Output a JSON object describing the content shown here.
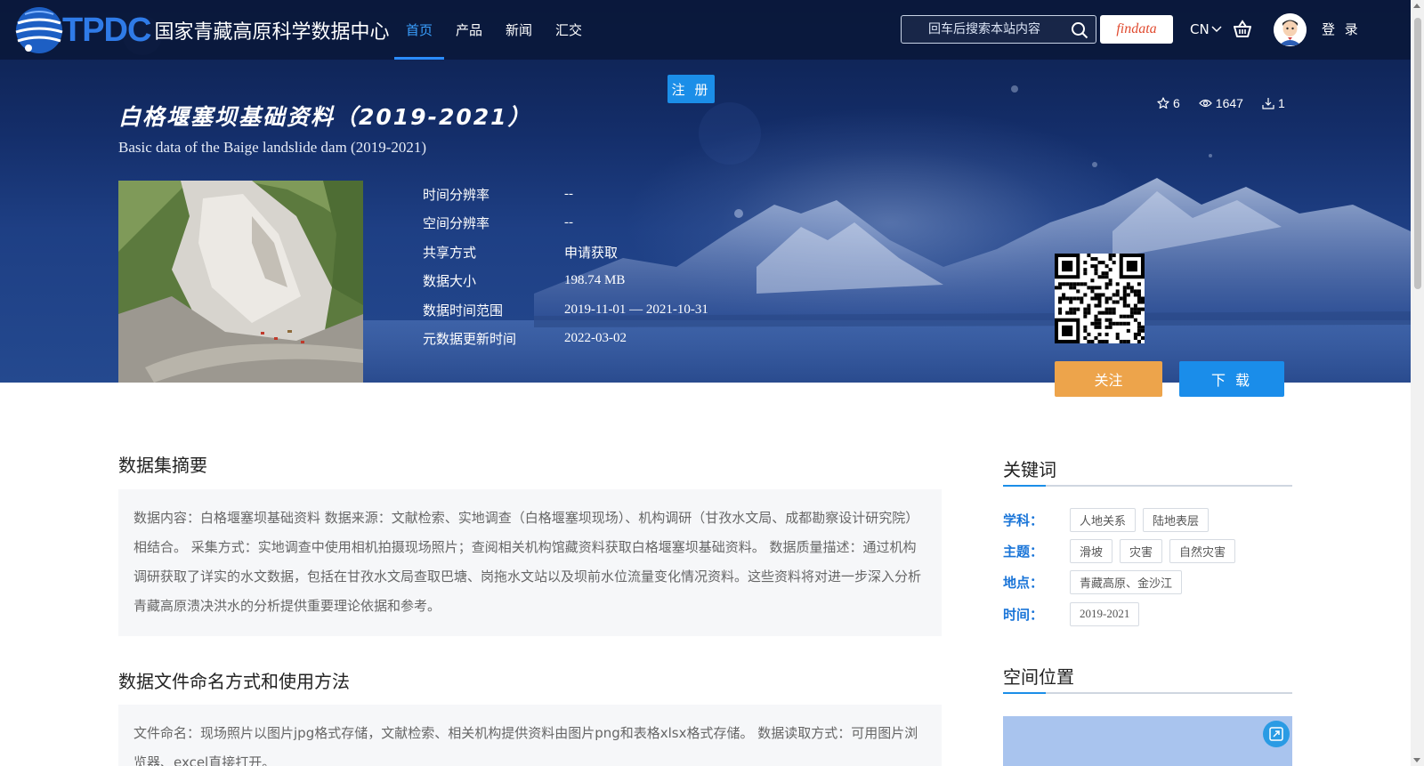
{
  "nav": {
    "logo_en": "TPDC",
    "logo_cn": "国家青藏高原科学数据中心",
    "menu": [
      {
        "label": "首页",
        "active": true
      },
      {
        "label": "产品",
        "active": false
      },
      {
        "label": "新闻",
        "active": false
      },
      {
        "label": "汇交",
        "active": false
      }
    ],
    "search_placeholder": "回车后搜索本站内容",
    "findata_label": "findata",
    "lang": "CN",
    "login": "登 录",
    "register": "注 册"
  },
  "dataset": {
    "title_cn": "白格堰塞坝基础资料（2019-2021）",
    "title_en": "Basic data of the Baige landslide dam (2019-2021)",
    "stats": {
      "stars": "6",
      "views": "1647",
      "downloads": "1"
    },
    "meta": [
      {
        "label": "时间分辨率",
        "value": "--"
      },
      {
        "label": "空间分辨率",
        "value": "--"
      },
      {
        "label": "共享方式",
        "value": "申请获取"
      },
      {
        "label": "数据大小",
        "value": "198.74 MB"
      },
      {
        "label": "数据时间范围",
        "value": "2019-11-01 — 2021-10-31"
      },
      {
        "label": "元数据更新时间",
        "value": "2022-03-02"
      }
    ],
    "follow_label": "关注",
    "download_label": "下 载"
  },
  "abstract": {
    "title": "数据集摘要",
    "text": "数据内容：白格堰塞坝基础资料 数据来源：文献检索、实地调查（白格堰塞坝现场）、机构调研（甘孜水文局、成都勘察设计研究院）相结合。 采集方式：实地调查中使用相机拍摄现场照片；查阅相关机构馆藏资料获取白格堰塞坝基础资料。 数据质量描述：通过机构调研获取了详实的水文数据，包括在甘孜水文局查取巴塘、岗拖水文站以及坝前水位流量变化情况资料。这些资料将对进一步深入分析青藏高原溃决洪水的分析提供重要理论依据和参考。"
  },
  "usage": {
    "title": "数据文件命名方式和使用方法",
    "text": "文件命名：现场照片以图片jpg格式存储，文献检索、相关机构提供资料由图片png和表格xlsx格式存储。 数据读取方式：可用图片浏览器、excel直接打开。"
  },
  "keywords": {
    "title": "关键词",
    "rows": [
      {
        "label": "学科：",
        "tags": [
          "人地关系",
          "陆地表层"
        ]
      },
      {
        "label": "主题：",
        "tags": [
          "滑坡",
          "灾害",
          "自然灾害"
        ]
      },
      {
        "label": "地点：",
        "tags": [
          "青藏高原、金沙江"
        ]
      },
      {
        "label": "时间：",
        "tags": [
          "2019-2021"
        ]
      }
    ]
  },
  "spatial": {
    "title": "空间位置"
  },
  "colors": {
    "accent": "#1b8ee8",
    "follow": "#eda44b",
    "nav_bg": "#0a183a",
    "keyword_label": "#1a75d8"
  },
  "icons": [
    "globe-logo-icon",
    "search-icon",
    "chevron-down-icon",
    "cart-icon",
    "avatar-icon",
    "star-icon",
    "eye-icon",
    "download-icon",
    "qr-code-icon",
    "map-expand-icon"
  ]
}
